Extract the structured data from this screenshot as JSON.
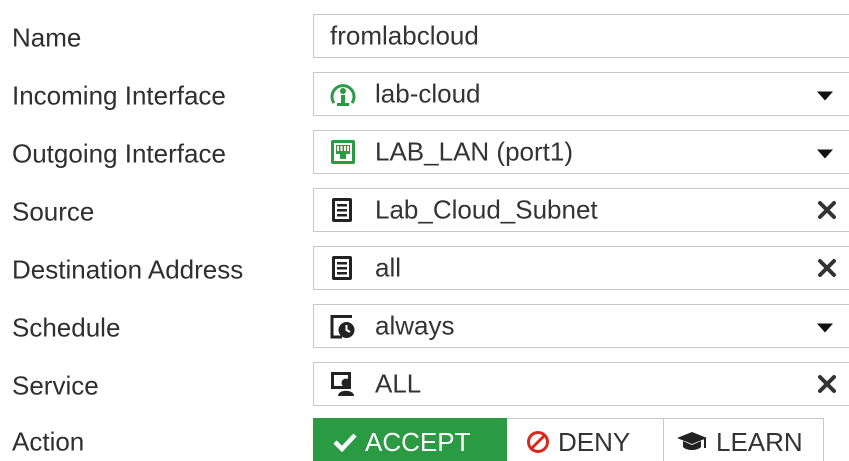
{
  "form": {
    "name": {
      "label": "Name",
      "value": "fromlabcloud"
    },
    "incoming": {
      "label": "Incoming Interface",
      "value": "lab-cloud",
      "icon": "tunnel-interface-icon",
      "icon_color": "#2a9a43"
    },
    "outgoing": {
      "label": "Outgoing Interface",
      "value": "LAB_LAN (port1)",
      "icon": "port-interface-icon",
      "icon_color": "#2a9a43"
    },
    "source": {
      "label": "Source",
      "value": "Lab_Cloud_Subnet",
      "icon": "address-icon"
    },
    "destination": {
      "label": "Destination Address",
      "value": "all",
      "icon": "address-icon"
    },
    "schedule": {
      "label": "Schedule",
      "value": "always",
      "icon": "schedule-icon"
    },
    "service": {
      "label": "Service",
      "value": "ALL",
      "icon": "service-group-icon"
    },
    "action": {
      "label": "Action",
      "options": [
        "ACCEPT",
        "DENY",
        "LEARN"
      ],
      "selected": "ACCEPT",
      "accept_color": "#2a9a43",
      "deny_color": "#d9281c"
    }
  }
}
